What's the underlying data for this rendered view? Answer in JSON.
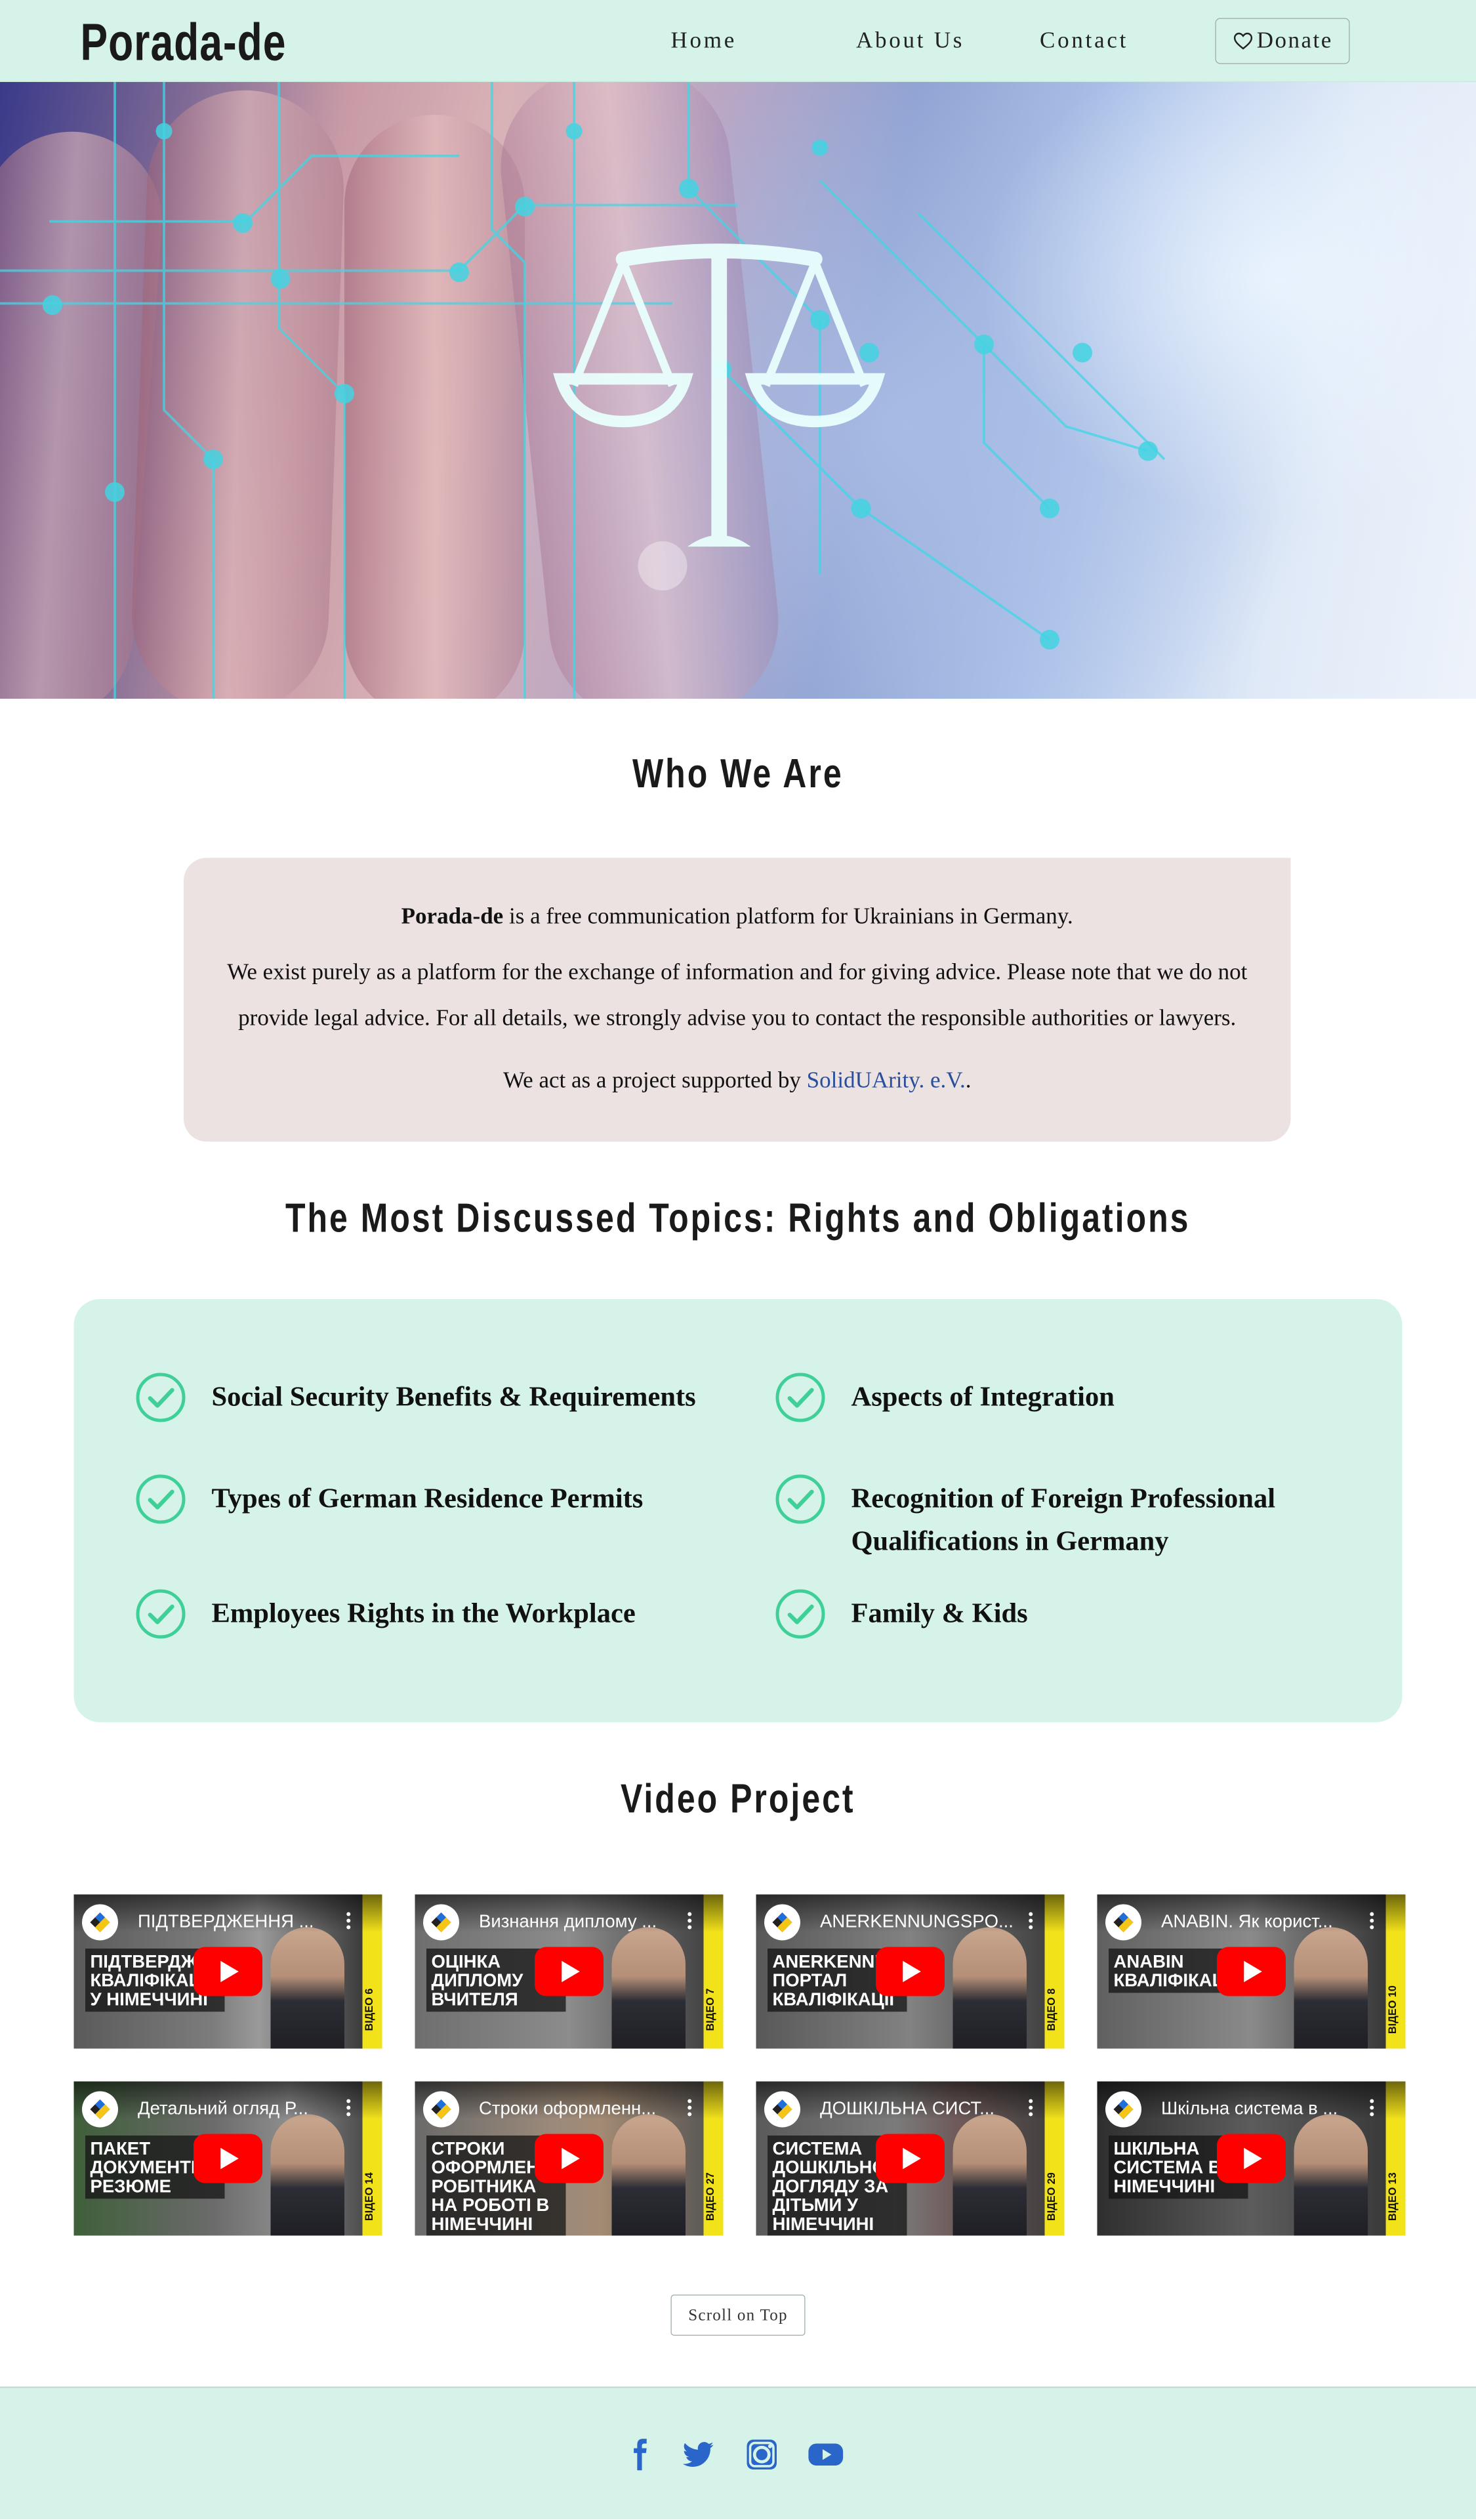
{
  "nav": {
    "brand": "Porada-de",
    "links": [
      "Home",
      "About Us",
      "Contact"
    ],
    "donate_label": "Donate"
  },
  "hero": {
    "image_alt_icon": "scales-of-justice-icon"
  },
  "who": {
    "title": "Who We Are",
    "brand_bold": "Porada-de",
    "intro_rest": " is a free communication platform for Ukrainians in Germany.",
    "para2": "We exist purely as a platform for the exchange of information and for giving advice. Please note that we do not provide legal advice. For all details, we strongly advise you to contact the responsible authorities or lawyers.",
    "para3_prefix": "We act as a project supported by ",
    "para3_link": "SolidUArity. e.V.",
    "para3_suffix": "."
  },
  "topics": {
    "title": "The Most Discussed Topics: Rights and Obligations",
    "items": [
      "Social Security Benefits & Requirements",
      "Aspects of Integration",
      "Types of German Residence Permits",
      "Recognition of Foreign Professional Qualifications in Germany",
      "Employees Rights in the Workplace",
      "Family & Kids"
    ]
  },
  "videos": {
    "title": "Video Project",
    "items": [
      {
        "title": "ПІДТВЕРДЖЕННЯ ...",
        "headline": "ПІДТВЕРДЖЕННЯ КВАЛІФІКАЦІЇ У НІМЕЧЧИНІ",
        "number": "ВІДЕО 6"
      },
      {
        "title": "Визнання диплому ...",
        "headline": "ОЦІНКА ДИПЛОМУ ВЧИТЕЛЯ",
        "number": "ВІДЕО 7"
      },
      {
        "title": "ANERKENNUNGSPO...",
        "headline": "ANERKENNUNGS ПОРТАЛ КВАЛІФІКАЦІЇ",
        "number": "ВІДЕО 8"
      },
      {
        "title": "ANABIN. Як корист...",
        "headline": "ANABIN КВАЛІФІКАЦІЇ",
        "number": "ВІДЕО 10"
      },
      {
        "title": "Детальний огляд Р...",
        "headline": "ПАКЕТ ДОКУМЕНТІВ РЕЗЮМЕ",
        "number": "ВІДЕО 14"
      },
      {
        "title": "Строки оформленн...",
        "headline": "СТРОКИ ОФОРМЛЕННЯ РОБІТНИКА НА РОБОТІ В НІМЕЧЧИНІ",
        "number": "ВІДЕО 27"
      },
      {
        "title": "ДОШКІЛЬНА СИСТ...",
        "headline": "СИСТЕМА ДОШКІЛЬНОГО ДОГЛЯДУ ЗА ДІТЬМИ У НІМЕЧЧИНІ",
        "number": "ВІДЕО 29"
      },
      {
        "title": "Шкільна система в ...",
        "headline": "ШКІЛЬНА СИСТЕМА В НІМЕЧЧИНІ",
        "number": "ВІДЕО 13"
      }
    ],
    "scroll_label": "Scroll on Top"
  },
  "footer": {
    "icons": [
      "facebook-icon",
      "twitter-icon",
      "instagram-icon",
      "youtube-icon"
    ],
    "accent": "#2a66c9"
  },
  "colors": {
    "mint": "#d6f3ea",
    "who_bg": "#ebe2e1",
    "check": "#3fcf98",
    "link": "#2a4f9a"
  }
}
